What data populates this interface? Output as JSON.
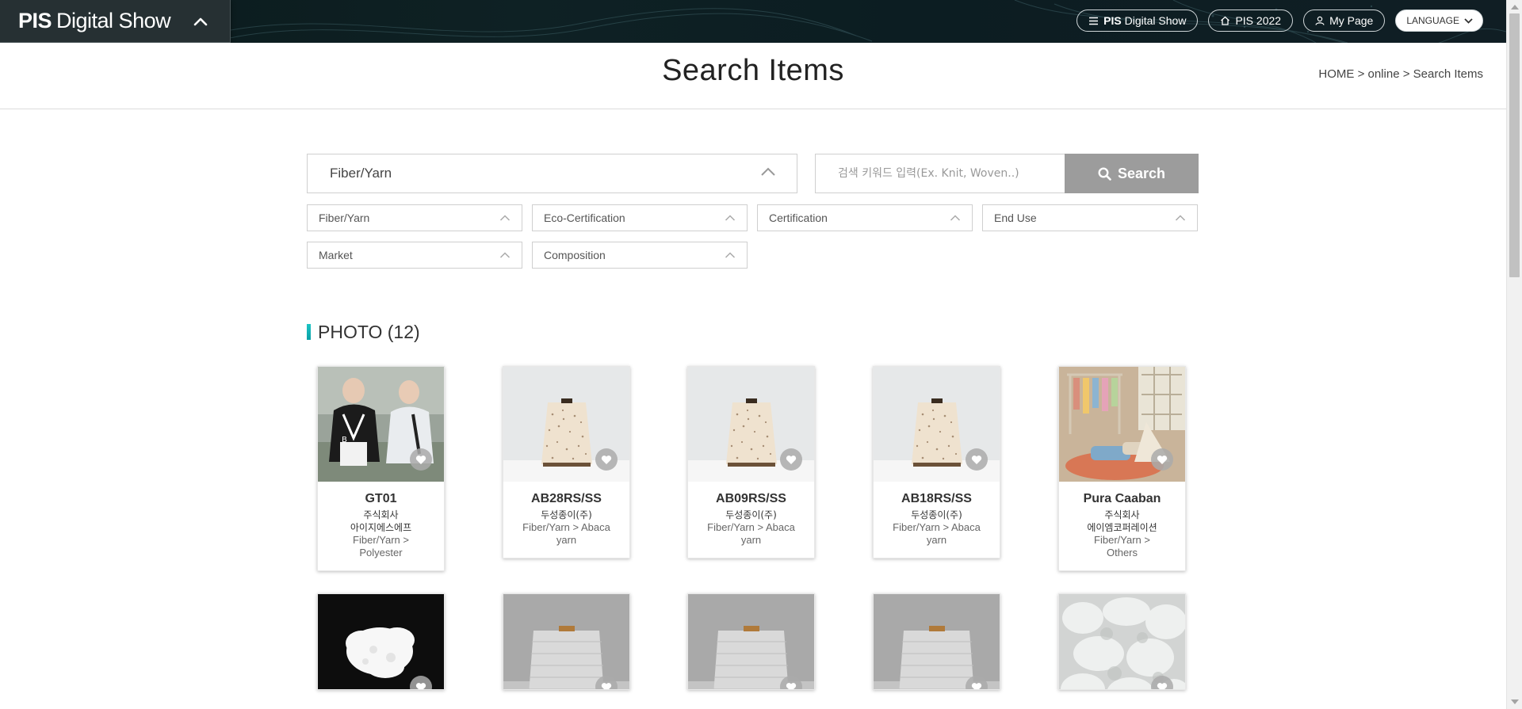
{
  "header": {
    "brand_bold": "PIS",
    "brand_rest": "Digital Show",
    "nav": {
      "digital_show_bold": "PIS",
      "digital_show_rest": "Digital Show",
      "pis2022": "PIS 2022",
      "mypage": "My Page",
      "language": "LANGUAGE"
    }
  },
  "page": {
    "title": "Search Items",
    "breadcrumb": "HOME > online > Search Items"
  },
  "search": {
    "category_value": "Fiber/Yarn",
    "keyword_placeholder": "검색 키워드 입력(Ex. Knit, Woven..)",
    "button_label": "Search",
    "filters": [
      "Fiber/Yarn",
      "Eco-Certification",
      "Certification",
      "End Use",
      "Market",
      "Composition"
    ]
  },
  "results": {
    "section_label": "PHOTO",
    "count_label": "(12)",
    "items": [
      {
        "name": "GT01",
        "maker": "주식회사 아이지에스에프",
        "maker_line1": "주식회사",
        "maker_line2": "아이지에스에프",
        "cat_line1": "Fiber/Yarn >",
        "cat_line2": "Polyester",
        "image": "golf-people-photo"
      },
      {
        "name": "AB28RS/SS",
        "maker_line1": "두성종이(주)",
        "maker_line2": "",
        "cat_line1": "Fiber/Yarn > Abaca",
        "cat_line2": "yarn",
        "image": "yarn-cone-speckled"
      },
      {
        "name": "AB09RS/SS",
        "maker_line1": "두성종이(주)",
        "maker_line2": "",
        "cat_line1": "Fiber/Yarn > Abaca",
        "cat_line2": "yarn",
        "image": "yarn-cone-speckled"
      },
      {
        "name": "AB18RS/SS",
        "maker_line1": "두성종이(주)",
        "maker_line2": "",
        "cat_line1": "Fiber/Yarn > Abaca",
        "cat_line2": "yarn",
        "image": "yarn-cone-speckled"
      },
      {
        "name": "Pura Caaban",
        "maker_line1": "주식회사",
        "maker_line2": "에이엠코퍼레이션",
        "cat_line1": "Fiber/Yarn >",
        "cat_line2": "Others",
        "image": "kids-room-photo"
      },
      {
        "image": "white-fiber-black-bg"
      },
      {
        "image": "grey-yarn-cone"
      },
      {
        "image": "grey-yarn-cone"
      },
      {
        "image": "grey-yarn-cone"
      },
      {
        "image": "white-fiber-closeup"
      }
    ]
  },
  "icons": {
    "heart": "heart-icon",
    "search": "search-icon",
    "chevron": "chevron-up-icon",
    "menu": "menu-icon",
    "home": "home-icon",
    "user": "user-icon"
  },
  "colors": {
    "accent": "#14b8b8",
    "search_button": "#9c9c9c",
    "topbar": "#0e2124"
  }
}
